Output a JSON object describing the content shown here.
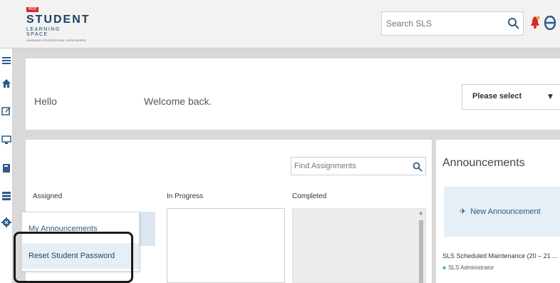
{
  "header": {
    "logo": {
      "badge": "MOE",
      "title": "STUDENT",
      "subtitle": "LEARNING SPACE",
      "tagline": "LEARNING FOR EVERYONE, EVERYWHERE"
    },
    "search": {
      "placeholder": "Search SLS",
      "value": ""
    },
    "icons": [
      "search-icon",
      "bell-icon",
      "user-icon"
    ]
  },
  "rail": {
    "items": [
      "menu-icon",
      "home-icon",
      "edit-icon",
      "monitor-icon",
      "book-icon",
      "server-icon",
      "gear-icon"
    ]
  },
  "greeting": {
    "hello": "Hello",
    "welcome": "Welcome back.",
    "select": {
      "value": "Please select"
    }
  },
  "assignments": {
    "find": {
      "placeholder": "Find Assignments",
      "value": ""
    },
    "columns": [
      "Assigned",
      "In Progress",
      "Completed"
    ]
  },
  "announcements": {
    "title": "Announcements",
    "new_button": "New Announcement",
    "items": [
      {
        "title": "SLS Scheduled Maintenance (20 – 21 ...",
        "by": "SLS Administrator"
      }
    ]
  },
  "popup": {
    "items": [
      "My Announcements",
      "Reset Student Password"
    ]
  },
  "colors": {
    "brand": "#1c3f63",
    "accent": "#2d5b86",
    "bell": "#d9262b",
    "link_bg": "#e6eef6"
  }
}
